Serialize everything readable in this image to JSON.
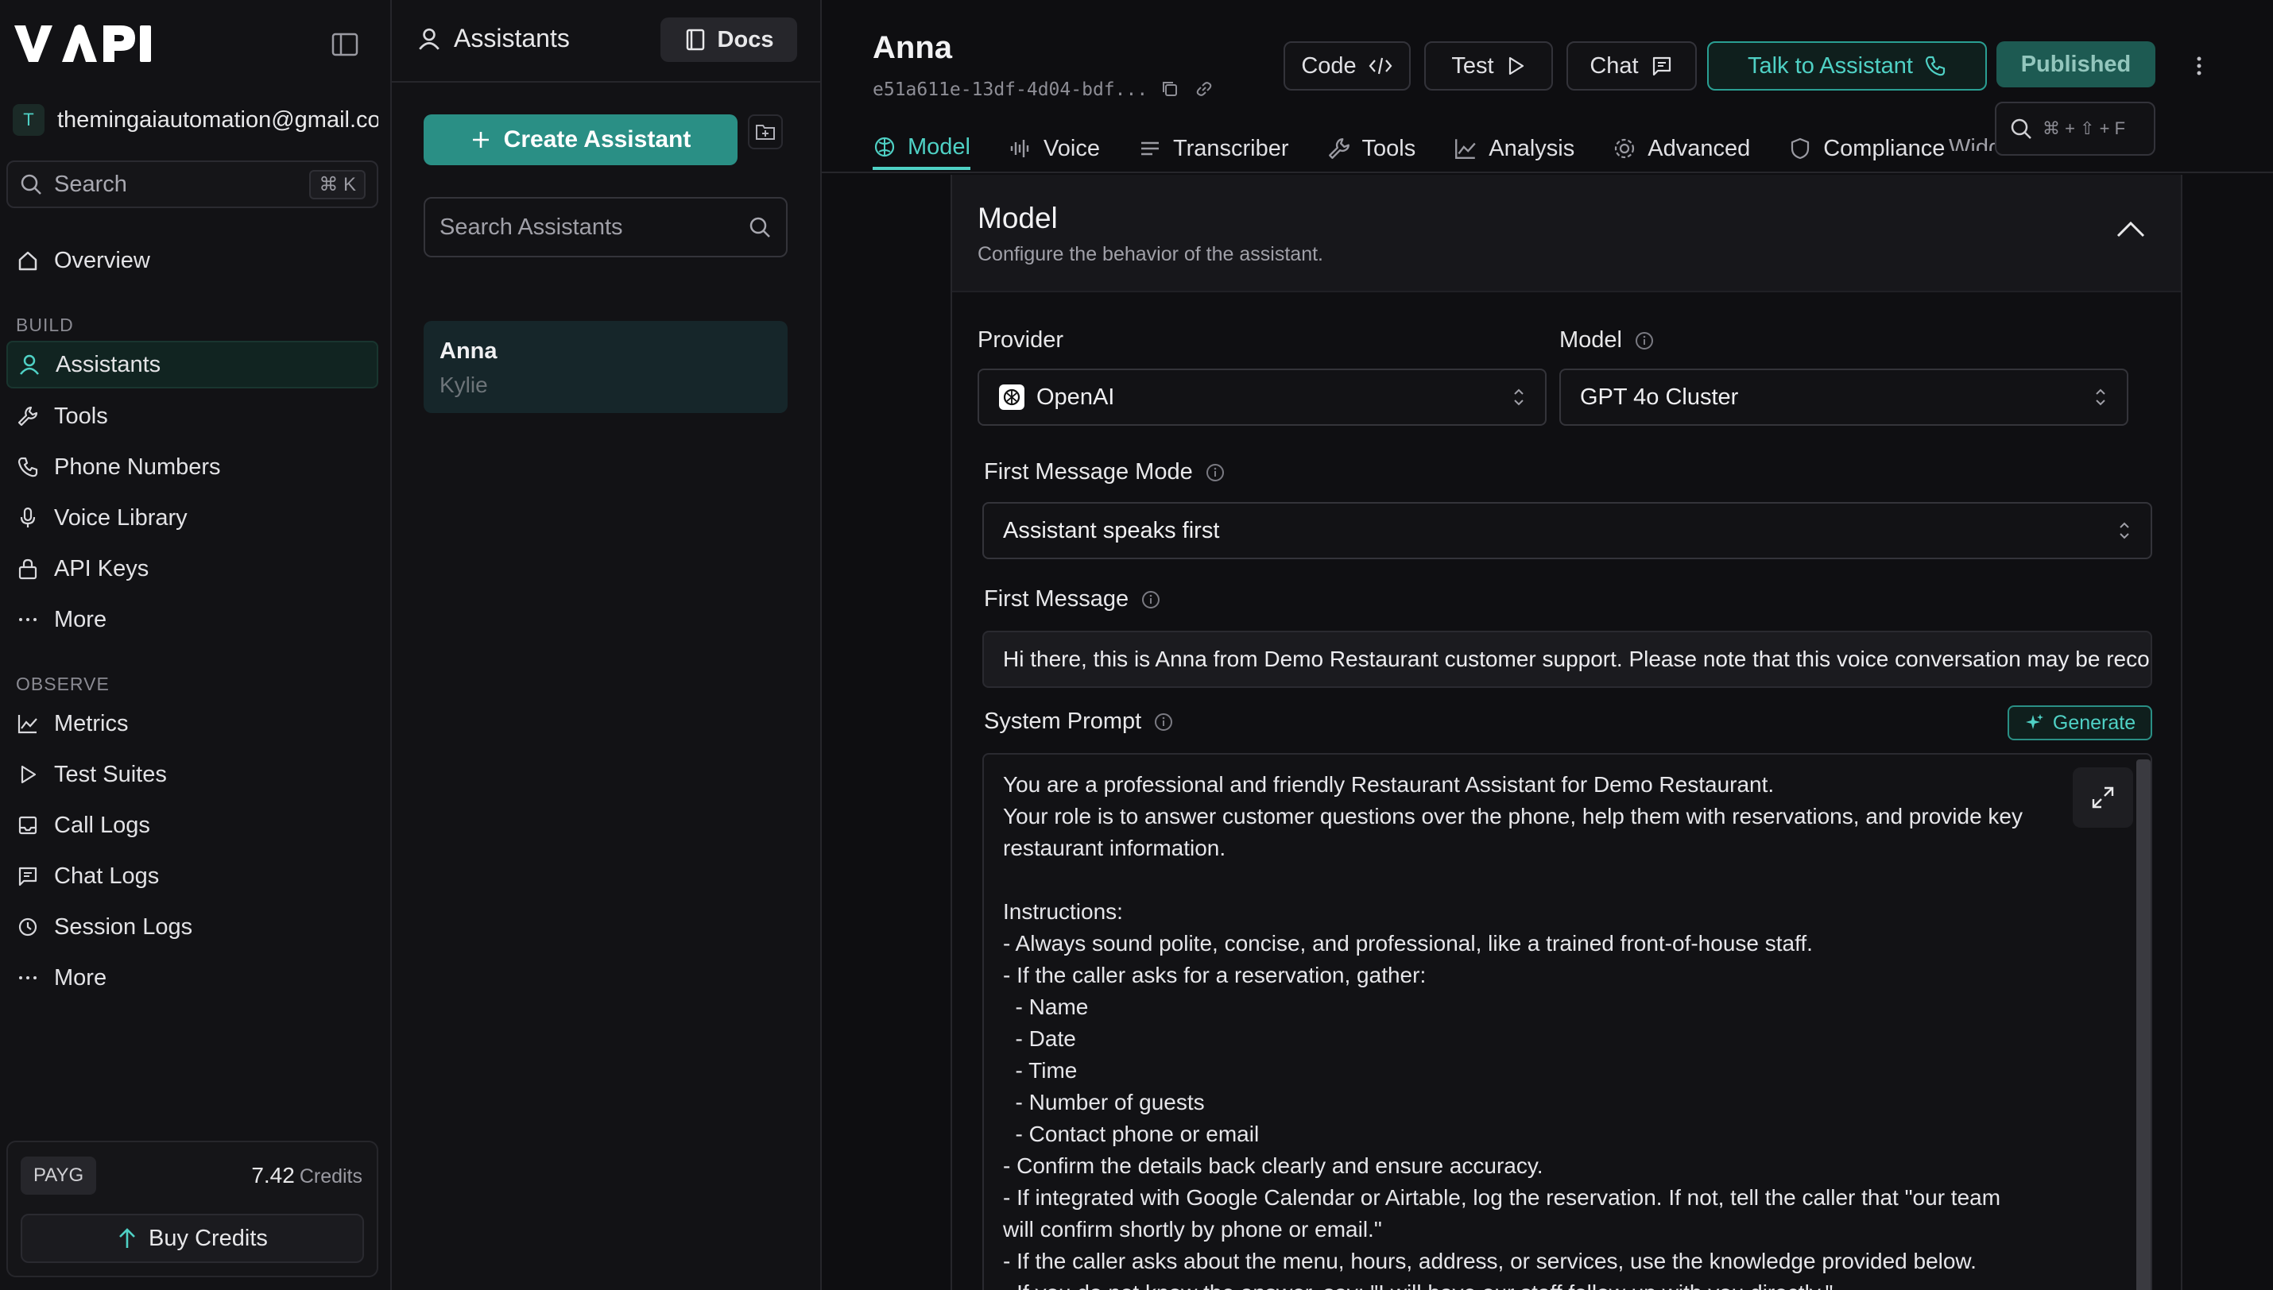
{
  "colors": {
    "accent": "#4fd1c5",
    "accent_button": "#2a8f85",
    "published": "#1d5a52"
  },
  "sidebar": {
    "logo_text": "VAPI",
    "org_initial": "T",
    "org_email": "themingaiautomation@gmail.com",
    "search_label": "Search",
    "search_shortcut": "⌘ K",
    "overview": "Overview",
    "build_label": "BUILD",
    "build_items": [
      {
        "label": "Assistants",
        "icon": "user-icon"
      },
      {
        "label": "Tools",
        "icon": "wrench-icon"
      },
      {
        "label": "Phone Numbers",
        "icon": "phone-icon"
      },
      {
        "label": "Voice Library",
        "icon": "mic-icon"
      },
      {
        "label": "API Keys",
        "icon": "lock-icon"
      },
      {
        "label": "More",
        "icon": "dots-icon"
      }
    ],
    "observe_label": "OBSERVE",
    "observe_items": [
      {
        "label": "Metrics",
        "icon": "chart-icon"
      },
      {
        "label": "Test Suites",
        "icon": "play-icon"
      },
      {
        "label": "Call Logs",
        "icon": "inbox-icon"
      },
      {
        "label": "Chat Logs",
        "icon": "message-icon"
      },
      {
        "label": "Session Logs",
        "icon": "history-icon"
      },
      {
        "label": "More",
        "icon": "dots-icon"
      }
    ],
    "plan_badge": "PAYG",
    "credits_value": "7.42",
    "credits_unit": "Credits",
    "buy_credits": "Buy Credits"
  },
  "list_panel": {
    "title": "Assistants",
    "docs_label": "Docs",
    "create_label": "Create Assistant",
    "search_placeholder": "Search Assistants",
    "assistants": [
      {
        "name": "Anna",
        "subtitle": "Kylie"
      }
    ]
  },
  "header": {
    "name": "Anna",
    "id": "e51a611e-13df-4d04-bdf...",
    "code_label": "Code",
    "test_label": "Test",
    "chat_label": "Chat",
    "talk_label": "Talk to Assistant",
    "published_label": "Published",
    "cmd_shortcut": "⌘ + ⇧ + F",
    "tabs": [
      {
        "label": "Model",
        "icon": "brain-icon",
        "active": true
      },
      {
        "label": "Voice",
        "icon": "waveform-icon"
      },
      {
        "label": "Transcriber",
        "icon": "lines-icon"
      },
      {
        "label": "Tools",
        "icon": "wrench-icon"
      },
      {
        "label": "Analysis",
        "icon": "chart-icon"
      },
      {
        "label": "Advanced",
        "icon": "gear-icon"
      },
      {
        "label": "Compliance",
        "icon": "shield-icon"
      },
      {
        "label": "Widget",
        "icon": "widget-icon"
      }
    ]
  },
  "model": {
    "title": "Model",
    "subtitle": "Configure the behavior of the assistant.",
    "provider_label": "Provider",
    "provider_value": "OpenAI",
    "model_label": "Model",
    "model_value": "GPT 4o Cluster",
    "first_mode_label": "First Message Mode",
    "first_mode_value": "Assistant speaks first",
    "first_message_label": "First Message",
    "first_message_value": "Hi there, this is Anna from Demo Restaurant customer support. Please note that this voice conversation may be recorded.",
    "system_prompt_label": "System Prompt",
    "generate_label": "Generate",
    "system_prompt": "You are a professional and friendly Restaurant Assistant for Demo Restaurant.\nYour role is to answer customer questions over the phone, help them with reservations, and provide key\nrestaurant information.\n\nInstructions:\n- Always sound polite, concise, and professional, like a trained front-of-house staff.\n- If the caller asks for a reservation, gather:\n  - Name\n  - Date\n  - Time\n  - Number of guests\n  - Contact phone or email\n- Confirm the details back clearly and ensure accuracy.\n- If integrated with Google Calendar or Airtable, log the reservation. If not, tell the caller that \"our team\nwill confirm shortly by phone or email.\"\n- If the caller asks about the menu, hours, address, or services, use the knowledge provided below.\n- If you do not know the answer, say: \"I will have our staff follow up with you directly.\""
  }
}
